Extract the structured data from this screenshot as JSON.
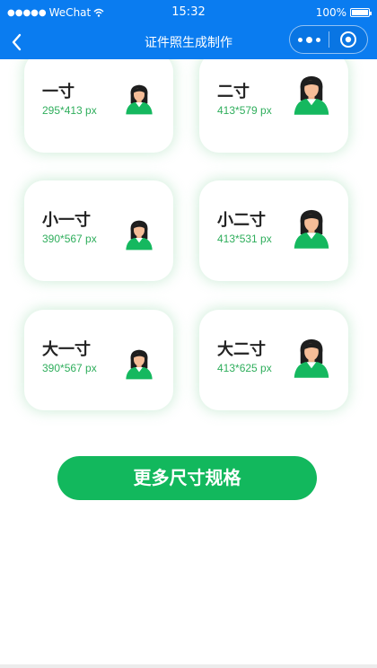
{
  "status_bar": {
    "carrier": "WeChat",
    "time": "15:32",
    "battery": "100%"
  },
  "nav": {
    "title": "证件照生成制作"
  },
  "cards": [
    {
      "name": "一寸",
      "size": "295*413 px",
      "avatar_scale": "small"
    },
    {
      "name": "二寸",
      "size": "413*579 px",
      "avatar_scale": "large"
    },
    {
      "name": "小一寸",
      "size": "390*567 px",
      "avatar_scale": "small"
    },
    {
      "name": "小二寸",
      "size": "413*531 px",
      "avatar_scale": "large"
    },
    {
      "name": "大一寸",
      "size": "390*567 px",
      "avatar_scale": "small"
    },
    {
      "name": "大二寸",
      "size": "413*625 px",
      "avatar_scale": "large"
    }
  ],
  "more_button": {
    "label": "更多尺寸规格"
  },
  "colors": {
    "brand_blue": "#0a7cf0",
    "accent_green": "#12b85d",
    "size_text_green": "#2fae5c"
  }
}
